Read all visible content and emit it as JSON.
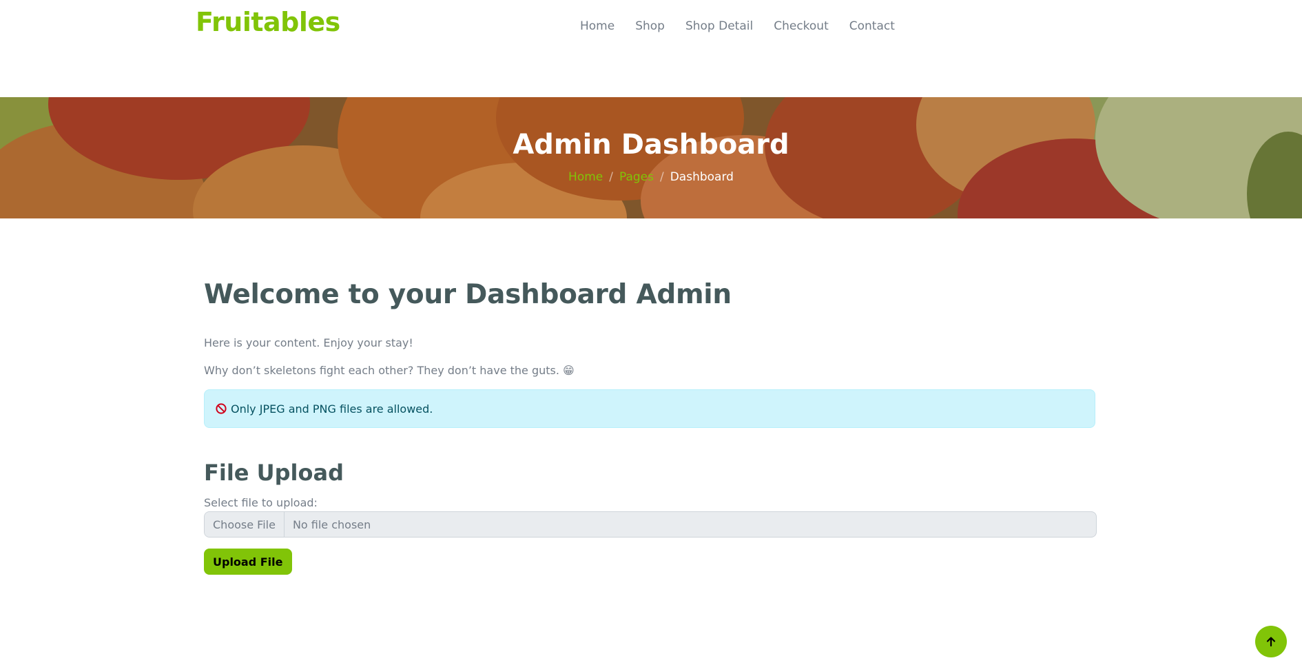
{
  "brand": "Fruitables",
  "nav": {
    "items": [
      "Home",
      "Shop",
      "Shop Detail",
      "Checkout",
      "Contact"
    ]
  },
  "hero": {
    "title": "Admin Dashboard",
    "breadcrumb": [
      "Home",
      "Pages",
      "Dashboard"
    ],
    "separator": "/"
  },
  "main": {
    "welcome": "Welcome to your Dashboard Admin",
    "intro": "Here is your content. Enjoy your stay!",
    "joke": "Why don’t skeletons fight each other? They don’t have the guts. 😁",
    "alert": "Only JPEG and PNG files are allowed.",
    "upload_title": "File Upload",
    "select_label": "Select file to upload:",
    "choose_label": "Choose File",
    "no_file": "No file chosen",
    "upload_button": "Upload File"
  },
  "colors": {
    "accent": "#81c408",
    "heading": "#45595b",
    "text": "#747d88",
    "alert_bg": "#cff4fc"
  },
  "icons": {
    "alert": "ban-icon",
    "back_to_top": "arrow-up-icon"
  }
}
